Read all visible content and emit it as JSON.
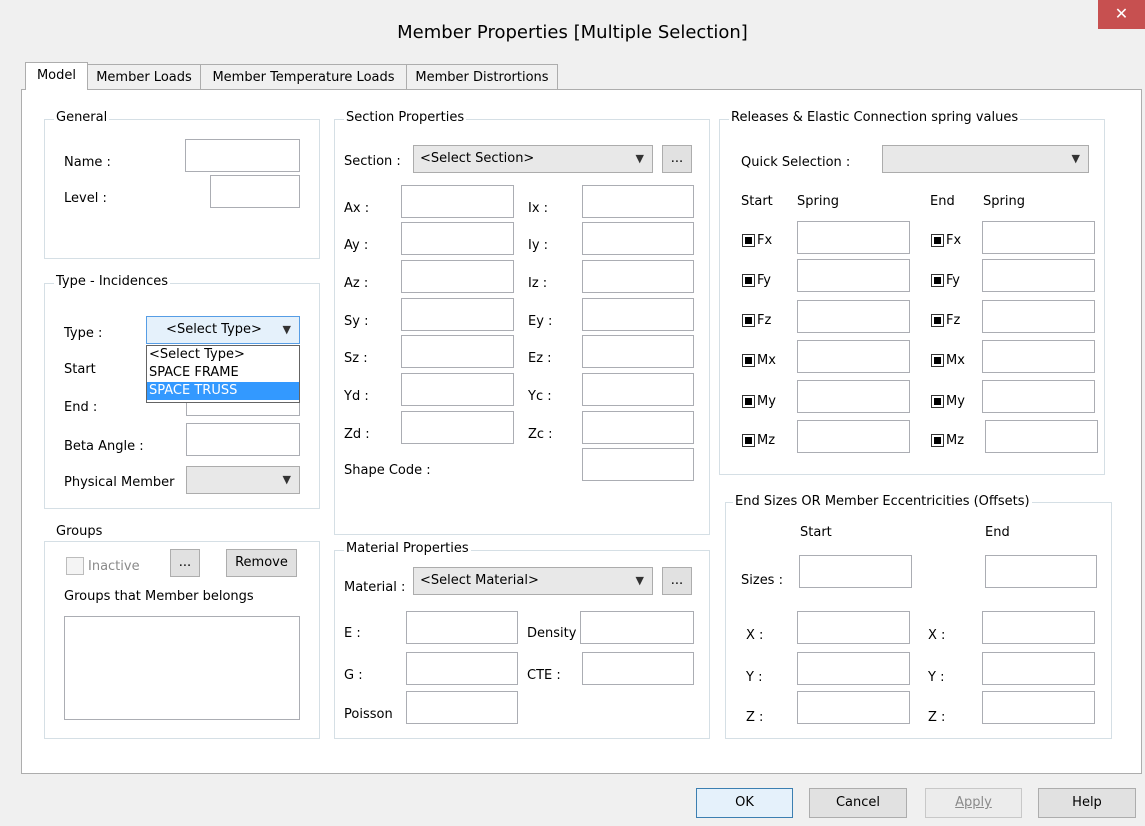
{
  "window": {
    "title": "Member Properties [Multiple Selection]",
    "close_glyph": "✕"
  },
  "tabs": [
    "Model",
    "Member Loads",
    "Member Temperature Loads",
    "Member Distrortions"
  ],
  "general": {
    "legend": "General",
    "name_label": "Name :",
    "level_label": "Level :"
  },
  "type_incidences": {
    "legend": "Type - Incidences",
    "type_label": "Type :",
    "type_value": "<Select Type>",
    "type_options": [
      "<Select Type>",
      "SPACE FRAME",
      "SPACE TRUSS"
    ],
    "start_label": "Start",
    "end_label": "End :",
    "beta_label": "Beta Angle :",
    "physical_label": "Physical Member"
  },
  "groups": {
    "legend": "Groups",
    "inactive_label": "Inactive",
    "more_label": "...",
    "remove_label": "Remove",
    "belongs_label": "Groups that Member belongs"
  },
  "section": {
    "legend": "Section Properties",
    "section_label": "Section :",
    "section_value": "<Select Section>",
    "more_label": "...",
    "left_labels": [
      "Ax :",
      "Ay :",
      "Az :",
      "Sy :",
      "Sz :",
      "Yd :",
      "Zd :"
    ],
    "right_labels": [
      "Ix :",
      "Iy :",
      "Iz :",
      "Ey :",
      "Ez :",
      "Yc :",
      "Zc :"
    ],
    "shape_code_label": "Shape Code :"
  },
  "material": {
    "legend": "Material Properties",
    "material_label": "Material :",
    "material_value": "<Select Material>",
    "more_label": "...",
    "e_label": "E :",
    "density_label": "Density",
    "g_label": "G :",
    "cte_label": "CTE :",
    "poisson_label": "Poisson"
  },
  "releases": {
    "legend": "Releases & Elastic Connection spring values",
    "quick_label": "Quick Selection :",
    "start_header": "Start",
    "spring_header": "Spring",
    "end_header": "End",
    "spring_header2": "Spring",
    "dofs": [
      "Fx",
      "Fy",
      "Fz",
      "Mx",
      "My",
      "Mz"
    ]
  },
  "offsets": {
    "legend": "End Sizes OR Member Eccentricities (Offsets)",
    "start_header": "Start",
    "end_header": "End",
    "sizes_label": "Sizes :",
    "x_label": "X :",
    "y_label": "Y :",
    "z_label": "Z :",
    "x_label2": "X :",
    "y_label2": "Y :",
    "z_label2": "Z :"
  },
  "footer": {
    "ok": "OK",
    "cancel": "Cancel",
    "apply": "Apply",
    "help": "Help"
  }
}
